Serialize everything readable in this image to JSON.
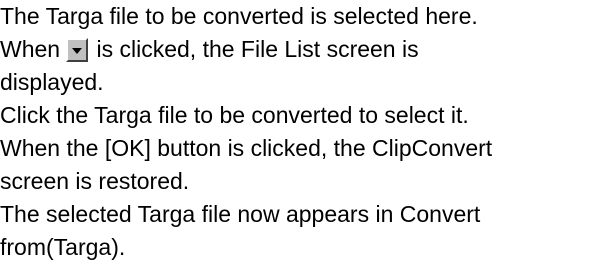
{
  "help": {
    "line1": "The Targa file to be converted is selected here.",
    "line2_before": "When",
    "line2_after": " is clicked, the File List screen is",
    "line3": "displayed.",
    "line4": "Click the Targa file to be converted to select it.",
    "line5": "When the [OK] button is clicked, the ClipConvert",
    "line6": "screen is restored.",
    "line7": "The selected Targa file now appears in Convert",
    "line8": "from(Targa)."
  },
  "icons": {
    "dropdown": "chevron-down-icon"
  },
  "colors": {
    "text": "#000000",
    "button_face": "#c0c0c0",
    "background": "#ffffff"
  }
}
